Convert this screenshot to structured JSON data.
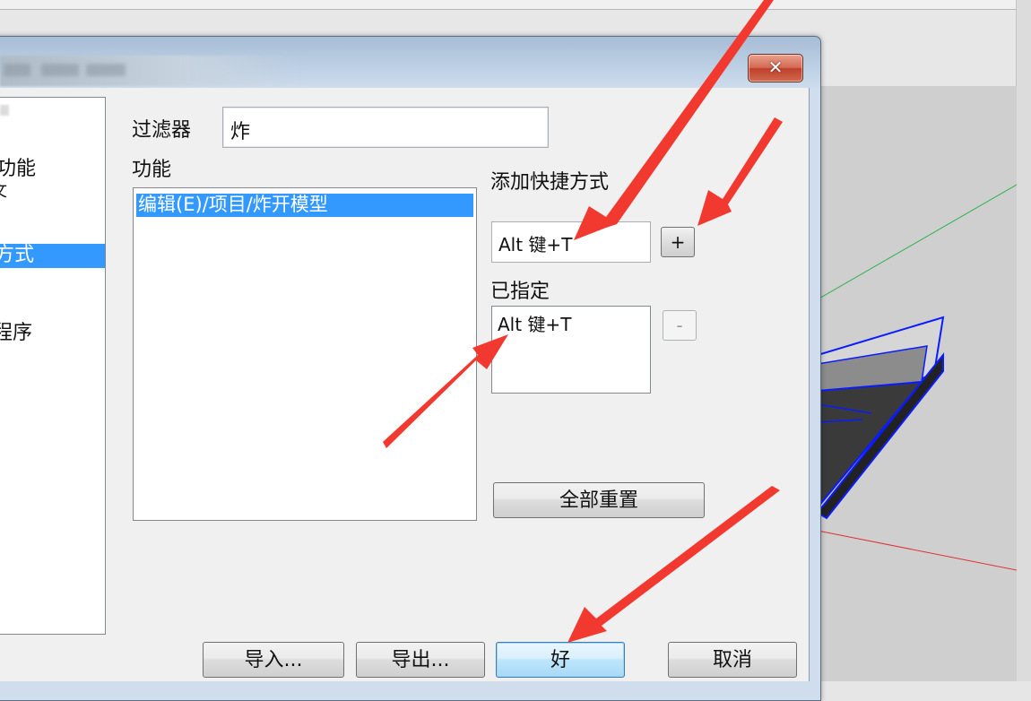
{
  "dialog": {
    "close_glyph": "✕"
  },
  "nav": {
    "items": [
      {
        "label": "功能"
      },
      {
        "label": "文"
      },
      {
        "label": "方式",
        "selected": true
      },
      {
        "label": "程序"
      }
    ]
  },
  "filter": {
    "label": "过滤器",
    "value": "炸"
  },
  "function_list": {
    "label": "功能",
    "items": [
      "编辑(E)/项目/炸开模型"
    ]
  },
  "add_shortcut": {
    "label": "添加快捷方式",
    "value": "Alt 键+T",
    "add_button": "+"
  },
  "assigned": {
    "label": "已指定",
    "items": [
      "Alt 键+T"
    ],
    "remove_button": "-"
  },
  "buttons": {
    "reset_all": "全部重置",
    "import": "导入...",
    "export": "导出...",
    "ok": "好",
    "cancel": "取消"
  },
  "colors": {
    "selection": "#3399ff",
    "annotation_arrow": "#f2392f",
    "model_edge": "#0a1cff"
  }
}
